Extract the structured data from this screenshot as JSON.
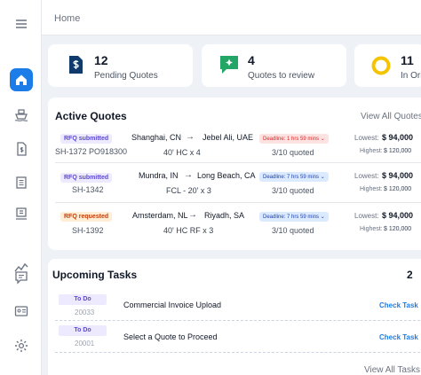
{
  "breadcrumb": "Home",
  "stats": [
    {
      "value": "12",
      "label": "Pending Quotes",
      "icon": "dollar-document-icon",
      "color": "#0f3a6b"
    },
    {
      "value": "4",
      "label": "Quotes to review",
      "icon": "sparkle-chat-icon",
      "color": "#22a565"
    },
    {
      "value": "11",
      "label": "In Orig",
      "icon": "ring-icon",
      "color": "#f5c400"
    }
  ],
  "active_quotes": {
    "title": "Active Quotes",
    "view_all": "View All Quotes",
    "rows": [
      {
        "status": "RFQ submitted",
        "ref": "SH-1372 PO918300",
        "origin": "Shanghai, CN",
        "destination": "Jebel Ali, UAE",
        "container": "40' HC x 4",
        "deadline": "Deadline: 1 hrs 59 mins",
        "quoted": "3/10 quoted",
        "lowest_label": "Lowest:",
        "lowest": "$ 94,000",
        "highest_label": "Highest:",
        "highest": "$ 120,000"
      },
      {
        "status": "RFQ submitted",
        "ref": "SH-1342",
        "origin": "Mundra, IN",
        "destination": "Long Beach, CA",
        "container": "FCL - 20' x 3",
        "deadline": "Deadline: 7 hrs 59 mins",
        "quoted": "3/10 quoted",
        "lowest_label": "Lowest:",
        "lowest": "$ 94,000",
        "highest_label": "Highest:",
        "highest": "$ 120,000"
      },
      {
        "status": "RFQ requested",
        "ref": "SH-1392",
        "origin": "Amsterdam, NL",
        "destination": "Riyadh, SA",
        "container": "40' HC RF x 3",
        "deadline": "Deadline: 7 hrs 59 mins",
        "quoted": "3/10 quoted",
        "lowest_label": "Lowest:",
        "lowest": "$ 94,000",
        "highest_label": "Highest:",
        "highest": "$ 120,000"
      }
    ]
  },
  "tasks": {
    "title": "Upcoming Tasks",
    "count": "2",
    "view_all": "View All Tasks",
    "items": [
      {
        "status": "To Do",
        "id": "20033",
        "name": "Commercial Invoice Upload",
        "action": "Check Task"
      },
      {
        "status": "To Do",
        "id": "20001",
        "name": "Select a Quote to Proceed",
        "action": "Check Task"
      }
    ]
  },
  "colors": {
    "accent": "#1d7de8",
    "sidebar_bg": "#ffffff",
    "page_bg": "#eef2f7"
  }
}
